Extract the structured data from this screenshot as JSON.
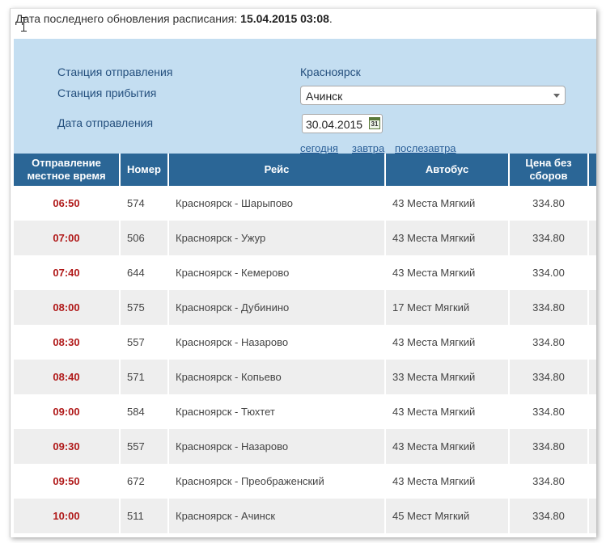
{
  "update": {
    "prefix": "Дата последнего обновления расписания: ",
    "datetime": "15.04.2015 03:08",
    "suffix": "."
  },
  "form": {
    "departure_label": "Станция отправления",
    "departure_value": "Красноярск",
    "arrival_label": "Станция прибытия",
    "arrival_value": "Ачинск",
    "date_label": "Дата отправления",
    "date_value": "30.04.2015",
    "calendar_icon_text": "31",
    "quick_dates": [
      "сегодня",
      "завтра",
      "послезавтра"
    ]
  },
  "table": {
    "headers": {
      "time": "Отправление местное время",
      "number": "Номер",
      "route": "Рейс",
      "bus": "Автобус",
      "price": "Цена без сборов"
    },
    "rows": [
      {
        "time": "06:50",
        "number": "574",
        "route": "Красноярск - Шарыпово",
        "bus": "43 Места Мягкий",
        "price": "334.80"
      },
      {
        "time": "07:00",
        "number": "506",
        "route": "Красноярск - Ужур",
        "bus": "43 Места Мягкий",
        "price": "334.80"
      },
      {
        "time": "07:40",
        "number": "644",
        "route": "Красноярск - Кемерово",
        "bus": "43 Места Мягкий",
        "price": "334.00"
      },
      {
        "time": "08:00",
        "number": "575",
        "route": "Красноярск - Дубинино",
        "bus": "17 Мест Мягкий",
        "price": "334.80"
      },
      {
        "time": "08:30",
        "number": "557",
        "route": "Красноярск - Назарово",
        "bus": "43 Места Мягкий",
        "price": "334.80"
      },
      {
        "time": "08:40",
        "number": "571",
        "route": "Красноярск - Копьево",
        "bus": "33 Места Мягкий",
        "price": "334.80"
      },
      {
        "time": "09:00",
        "number": "584",
        "route": "Красноярск - Тюхтет",
        "bus": "43 Места Мягкий",
        "price": "334.80"
      },
      {
        "time": "09:30",
        "number": "557",
        "route": "Красноярск - Назарово",
        "bus": "43 Места Мягкий",
        "price": "334.80"
      },
      {
        "time": "09:50",
        "number": "672",
        "route": "Красноярск - Преображенский",
        "bus": "43 Места Мягкий",
        "price": "334.80"
      },
      {
        "time": "10:00",
        "number": "511",
        "route": "Красноярск - Ачинск",
        "bus": "45 Мест Мягкий",
        "price": "334.80"
      }
    ]
  },
  "colors": {
    "header_bg": "#2b6696",
    "panel_bg": "#c4def1",
    "time_text": "#b01919",
    "link": "#2a5f98"
  }
}
